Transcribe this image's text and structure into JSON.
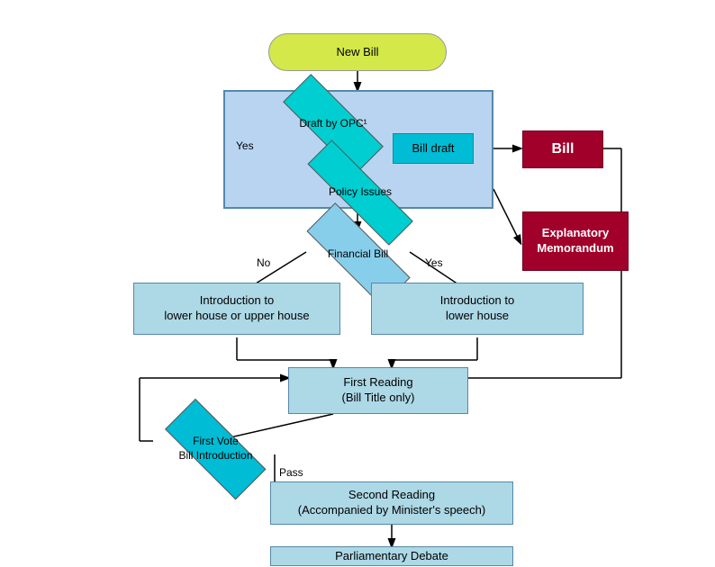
{
  "nodes": {
    "new_bill": {
      "label": "New Bill"
    },
    "draft_opc": {
      "label": "Draft by OPC¹"
    },
    "bill_draft": {
      "label": "Bill draft"
    },
    "policy_issues": {
      "label": "Policy Issues"
    },
    "yes_label": {
      "label": "Yes"
    },
    "bill_box": {
      "label": "Bill"
    },
    "explanatory_memo": {
      "label": "Explanatory\nMemorandum"
    },
    "financial_bill": {
      "label": "Financial Bill"
    },
    "no_label": {
      "label": "No"
    },
    "yes2_label": {
      "label": "Yes"
    },
    "intro_lower_upper": {
      "label": "Introduction to\nlower house or upper house"
    },
    "intro_lower": {
      "label": "Introduction to\nlower house"
    },
    "first_reading": {
      "label": "First Reading\n(Bill Title only)"
    },
    "first_vote": {
      "label": "First Vote\nBill Introduction"
    },
    "pass_label": {
      "label": "Pass"
    },
    "second_reading": {
      "label": "Second Reading\n(Accompanied by Minister's speech)"
    },
    "parliamentary_debate": {
      "label": "Parliamentary Debate"
    }
  }
}
